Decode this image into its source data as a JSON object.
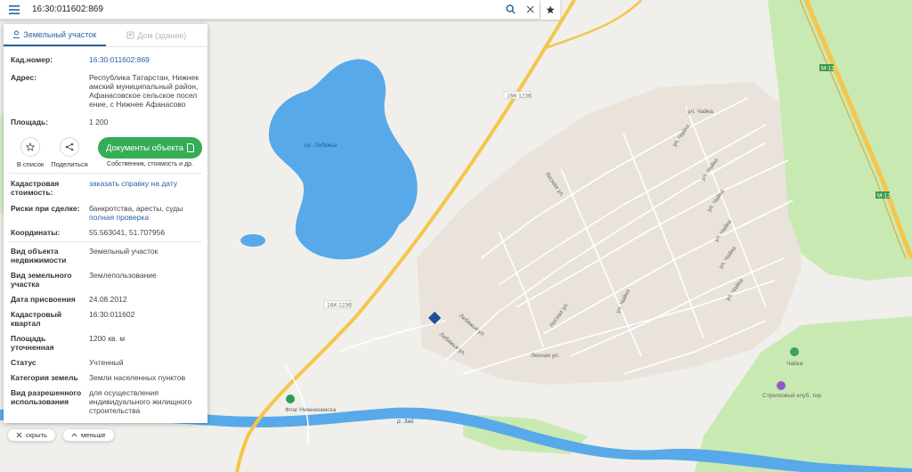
{
  "search": {
    "value": "16:30:011602:869"
  },
  "tabs": [
    "Земельный участок",
    "Дом (здание)"
  ],
  "info": {
    "cad_label": "Кад.номер:",
    "cad_value": "16:30:011602:869",
    "address_label": "Адрес:",
    "address_value": "Республика Татарстан, Нижнекамский муниципальный район, Афанасовское сельское поселение, с Нижнее Афанасово",
    "area_label": "Площадь:",
    "area_value": "1 200"
  },
  "actions": {
    "list": "В список",
    "share": "Поделиться",
    "docs": "Документы объекта",
    "docs_sub": "Собственник, стоимость и др."
  },
  "details": {
    "value_label": "Кадастровая стоимость:",
    "value_link": "заказать справку на дату",
    "risks_label": "Риски при сделке:",
    "risks_value": "банкротства, аресты, суды",
    "risks_link": "полная проверка",
    "coords_label": "Координаты:",
    "coords_value": "55.563041, 51.707956",
    "type_label": "Вид объекта недвижимости",
    "type_value": "Земельный участок",
    "landtype_label": "Вид земельного участка",
    "landtype_value": "Землепользование",
    "date_label": "Дата присвоения",
    "date_value": "24.08.2012",
    "quarter_label": "Кадастровый квартал",
    "quarter_value": "16:30:011602",
    "area_label": "Площадь уточненная",
    "area_value": "1200 кв. м",
    "status_label": "Статус",
    "status_value": "Учтенный",
    "cat_label": "Категория земель",
    "cat_value": "Земли населенных пунктов",
    "use_label": "Вид разрешенного использования",
    "use_value": "для осуществления индивидуального жилищного строительства"
  },
  "controls": {
    "hide": "скрыть",
    "less": "меньше"
  },
  "map": {
    "lake": "оз. Лебяжье",
    "road1": "16К-1236",
    "road2": "16К-1236",
    "m12a": "М-12",
    "m12b": "М-12",
    "streets": [
      "ул. Чайка",
      "ул. Чайка",
      "ул. Чайка",
      "ул. Чайка",
      "ул. Чайка",
      "ул. Чайка",
      "ул. Чайка",
      "ул. Чайка",
      "Лесная ул.",
      "Лесная ул.",
      "Лесная ул.",
      "Лебяжья ул.",
      "Лебяжья ул."
    ],
    "poi_flag": "Флаг Нижнекамска",
    "poi_chaika": "Чайка",
    "poi_club": "Стрелковый клуб, тир",
    "river": "р. Зай"
  },
  "colors": {
    "water": "#58a9e9",
    "forest": "#c6e8b0",
    "accent": "#2a63a5",
    "green_button": "#35ad56",
    "parcel": "#1f4f96",
    "road": "#f4c64b"
  }
}
